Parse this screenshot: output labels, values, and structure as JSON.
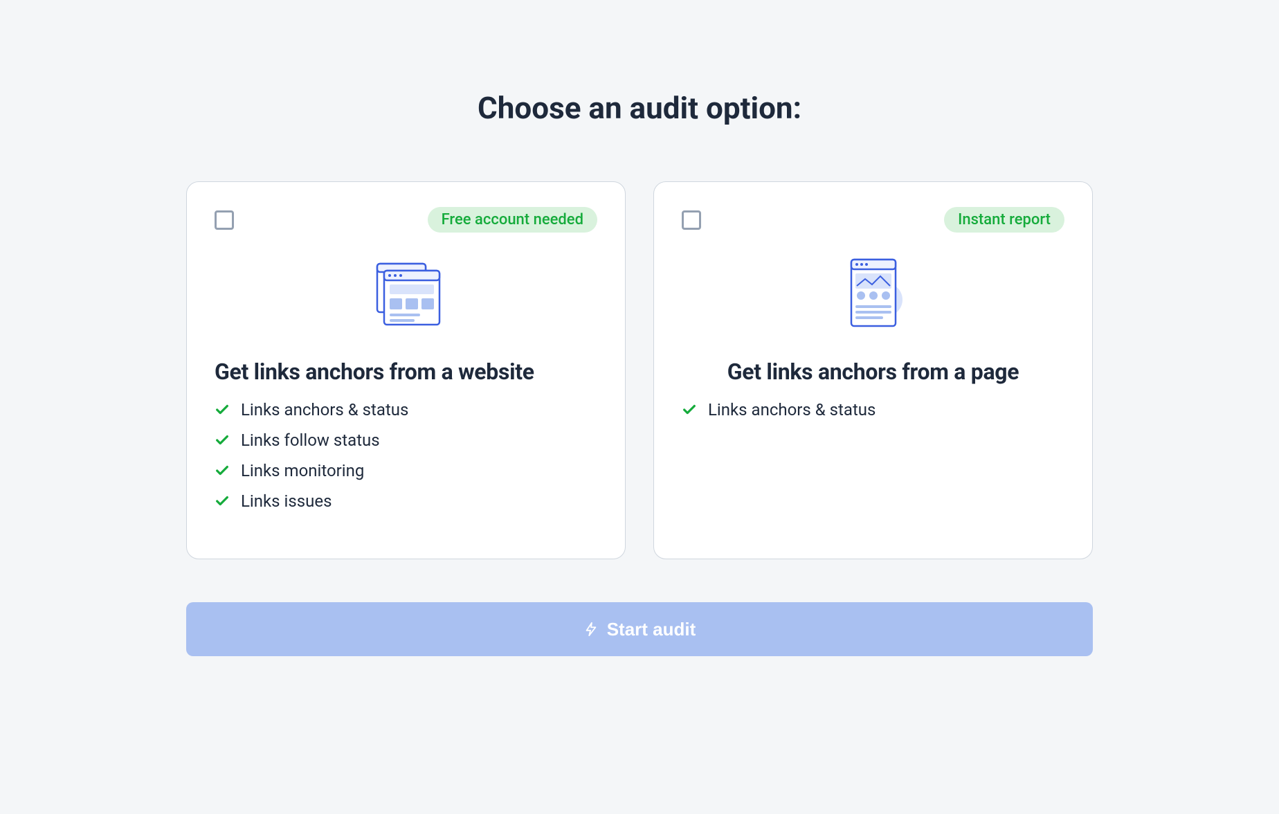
{
  "title": "Choose an audit option:",
  "cards": [
    {
      "badge": "Free account needed",
      "title": "Get links anchors from a website",
      "features": [
        "Links anchors & status",
        "Links follow status",
        "Links monitoring",
        "Links issues"
      ]
    },
    {
      "badge": "Instant report",
      "title": "Get links anchors from a page",
      "features": [
        "Links anchors & status"
      ]
    }
  ],
  "start_button": "Start audit"
}
